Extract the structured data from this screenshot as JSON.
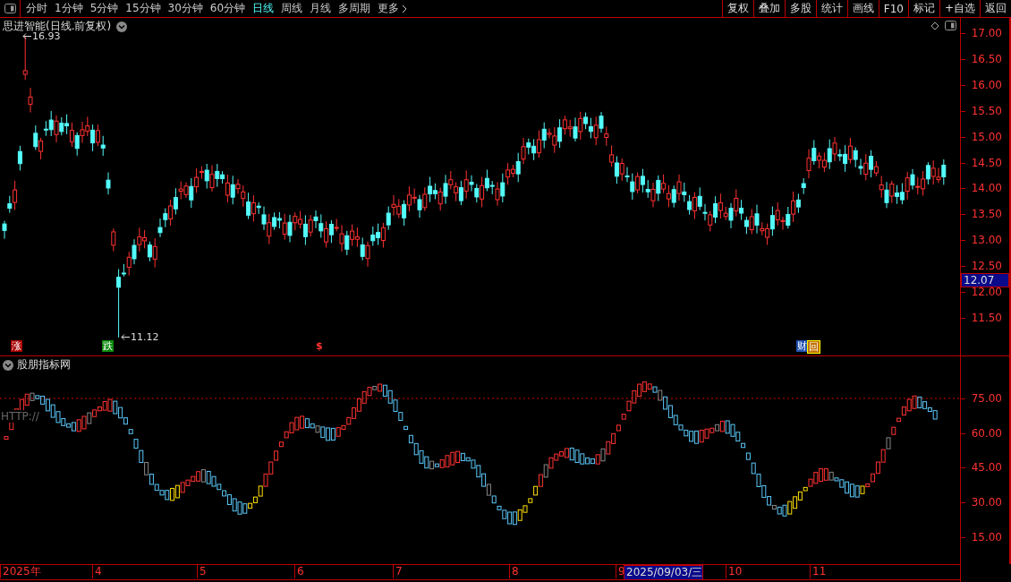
{
  "toolbar": {
    "periods": [
      {
        "label": "分时",
        "selected": false
      },
      {
        "label": "1分钟",
        "selected": false
      },
      {
        "label": "5分钟",
        "selected": false
      },
      {
        "label": "15分钟",
        "selected": false
      },
      {
        "label": "30分钟",
        "selected": false
      },
      {
        "label": "60分钟",
        "selected": false
      },
      {
        "label": "日线",
        "selected": true
      },
      {
        "label": "周线",
        "selected": false
      },
      {
        "label": "月线",
        "selected": false
      },
      {
        "label": "多周期",
        "selected": false
      },
      {
        "label": "更多",
        "selected": false
      }
    ],
    "actions": [
      "复权",
      "叠加",
      "多股",
      "统计",
      "画线",
      "F10",
      "标记",
      "+自选",
      "返回"
    ]
  },
  "price_panel": {
    "title": "思进智能(日线.前复权)",
    "high_label": "16.93",
    "low_label": "11.12",
    "markers": [
      {
        "text": "涨",
        "kind": "up"
      },
      {
        "text": "跌",
        "kind": "down"
      },
      {
        "text": "$",
        "kind": "signal"
      },
      {
        "text": "财",
        "kind": "finance"
      },
      {
        "text": "回",
        "kind": "review"
      }
    ],
    "axis_ticks": [
      "17.00",
      "16.50",
      "16.00",
      "15.50",
      "15.00",
      "14.50",
      "14.00",
      "13.50",
      "13.00",
      "12.50",
      "12.00",
      "11.50"
    ],
    "current_price": "12.07"
  },
  "indicator_panel": {
    "title": "股朋指标网",
    "overlay_text": "HTTP://",
    "axis_ticks": [
      "75.00",
      "60.00",
      "45.00",
      "30.00",
      "15.00"
    ]
  },
  "timeline": {
    "labels": [
      {
        "text": "2025年",
        "selected": false
      },
      {
        "text": "4",
        "selected": false
      },
      {
        "text": "5",
        "selected": false
      },
      {
        "text": "6",
        "selected": false
      },
      {
        "text": "7",
        "selected": false
      },
      {
        "text": "8",
        "selected": false
      },
      {
        "text": "9",
        "selected": false
      },
      {
        "text": "2025/09/03/三",
        "selected": true
      },
      {
        "text": "10",
        "selected": false
      },
      {
        "text": "11",
        "selected": false
      }
    ]
  }
}
